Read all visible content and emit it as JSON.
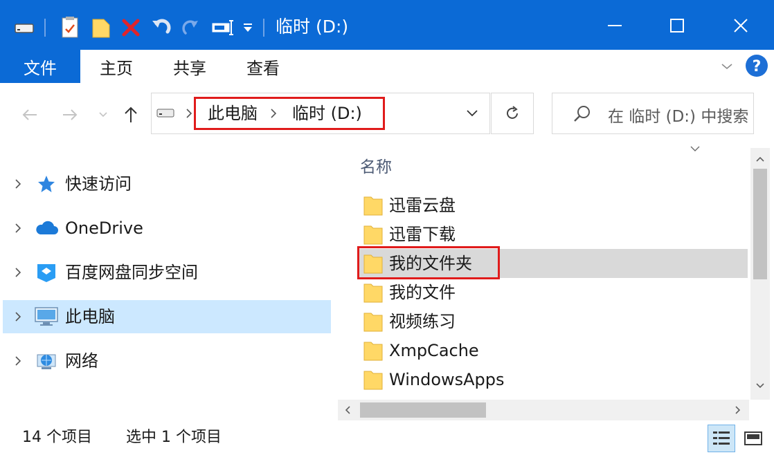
{
  "window": {
    "title": "临时 (D:)",
    "accent_color": "#0b6ad6",
    "selection_color": "#cce8ff",
    "highlight_color": "#e01b1b"
  },
  "quick_access_toolbar": {
    "icons": [
      "drive-icon",
      "properties-icon",
      "new-folder-icon",
      "delete-icon",
      "redo-icon",
      "undo-icon",
      "rename-icon",
      "customize-dropdown-icon"
    ]
  },
  "window_controls": {
    "minimize": "minimize-icon",
    "maximize": "maximize-icon",
    "close": "close-icon"
  },
  "ribbon": {
    "tabs": [
      {
        "label": "文件",
        "active": true
      },
      {
        "label": "主页"
      },
      {
        "label": "共享"
      },
      {
        "label": "查看"
      }
    ]
  },
  "address_bar": {
    "breadcrumbs": [
      "此电脑",
      "临时 (D:)"
    ],
    "search_placeholder": "在 临时 (D:) 中搜索"
  },
  "navigation_pane": {
    "items": [
      {
        "label": "快速访问",
        "icon": "star-icon",
        "selected": false
      },
      {
        "label": "OneDrive",
        "icon": "cloud-icon",
        "selected": false
      },
      {
        "label": "百度网盘同步空间",
        "icon": "baidu-netdisk-icon",
        "selected": false
      },
      {
        "label": "此电脑",
        "icon": "computer-icon",
        "selected": true
      },
      {
        "label": "网络",
        "icon": "network-icon",
        "selected": false
      }
    ]
  },
  "file_list": {
    "column_name": "名称",
    "items": [
      {
        "name": "迅雷云盘",
        "selected": false
      },
      {
        "name": "迅雷下载",
        "selected": false
      },
      {
        "name": "我的文件夹",
        "selected": true
      },
      {
        "name": "我的文件",
        "selected": false
      },
      {
        "name": "视频练习",
        "selected": false
      },
      {
        "name": "XmpCache",
        "selected": false
      },
      {
        "name": "WindowsApps",
        "selected": false
      }
    ]
  },
  "status_bar": {
    "item_count": "14 个项目",
    "selected_count": "选中 1 个项目"
  }
}
